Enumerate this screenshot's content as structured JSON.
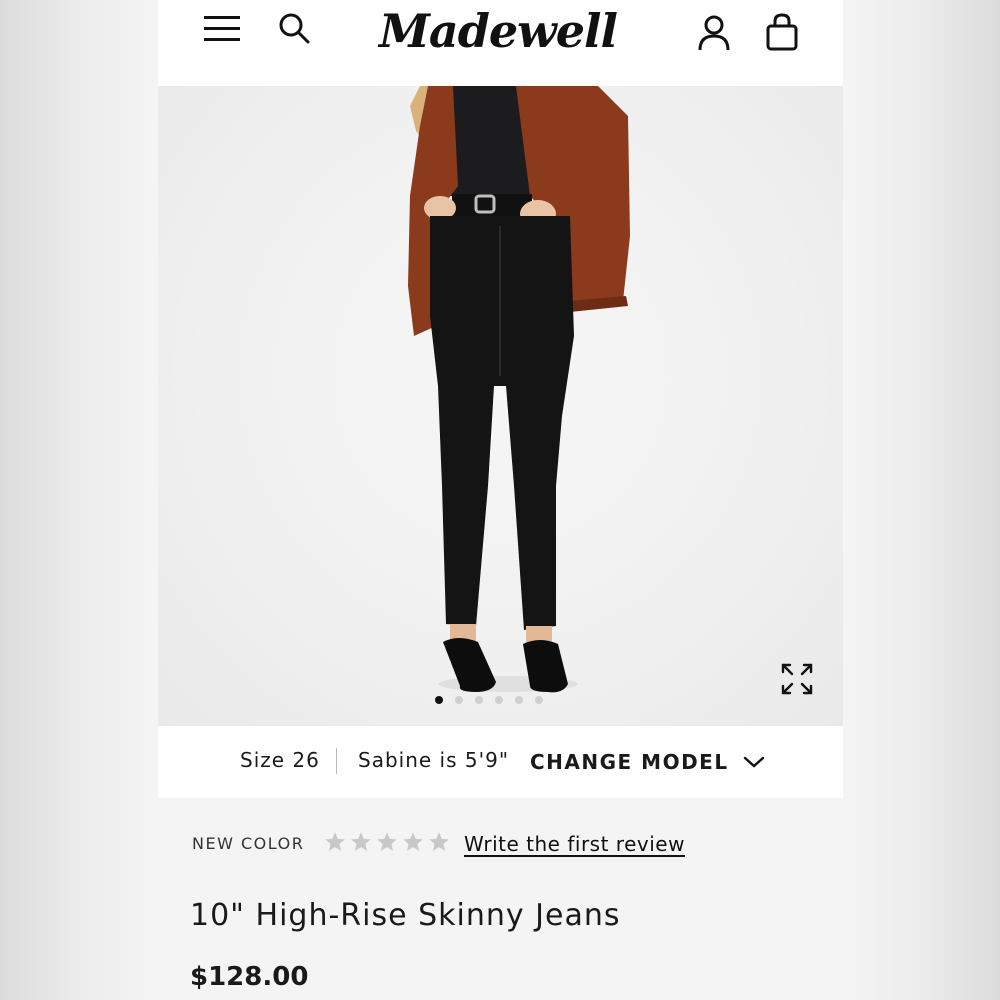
{
  "header": {
    "logo_text": "Madewell",
    "icons": [
      "menu-icon",
      "search-icon",
      "account-icon",
      "bag-icon"
    ]
  },
  "gallery": {
    "total_images": 6,
    "active_index": 0,
    "expand_icon": "expand-icon"
  },
  "model_bar": {
    "size_label": "Size 26",
    "model_height": "Sabine is 5'9\"",
    "change_model_label": "CHANGE MODEL",
    "chevron_icon": "chevron-down-icon"
  },
  "product": {
    "badge": "NEW COLOR",
    "rating": 0,
    "rating_max": 5,
    "review_link": "Write the first review",
    "title": "10\" High-Rise Skinny Jeans",
    "price": "$128.00"
  },
  "colors": {
    "jacket": "#8b3a1c",
    "jeans": "#141414",
    "star_empty": "#c8c8c8"
  }
}
